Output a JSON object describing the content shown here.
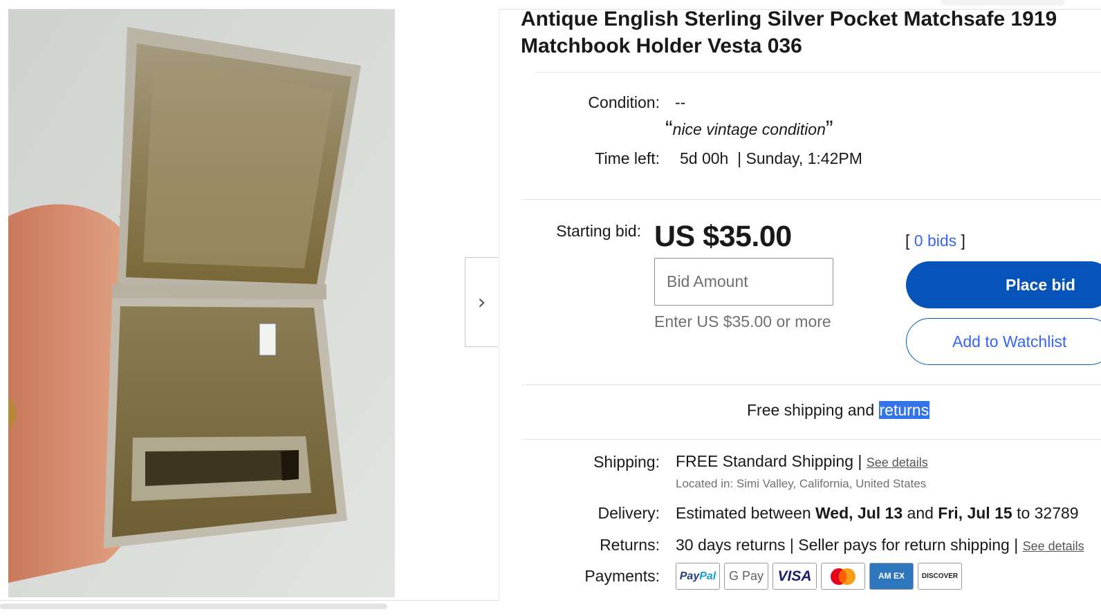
{
  "listing": {
    "title": "Antique English Sterling Silver Pocket Matchsafe 1919 Matchbook Holder Vesta 036",
    "condition_label": "Condition:",
    "condition_value": "--",
    "seller_note": "nice vintage condition",
    "time_left_label": "Time left:",
    "time_left_value": "5d 00h",
    "time_left_sep": "|",
    "end_time": "Sunday, 1:42PM"
  },
  "bidding": {
    "starting_bid_label": "Starting bid:",
    "price": "US $35.00",
    "bids_open": "[",
    "bids_link": "0 bids",
    "bids_close": "]",
    "bid_placeholder": "Bid Amount",
    "bid_hint": "Enter US $35.00 or more",
    "place_bid_label": "Place bid",
    "watchlist_label": "Add to Watchlist"
  },
  "banner": {
    "text": "Free shipping and",
    "highlight": "returns"
  },
  "details": {
    "shipping_label": "Shipping:",
    "shipping_bold": "FREE",
    "shipping_text": "Standard Shipping |",
    "shipping_link": "See details",
    "located_in": "Located in: Simi Valley, California, United States",
    "delivery_label": "Delivery:",
    "delivery_pre": "Estimated between",
    "delivery_date1": "Wed, Jul 13",
    "delivery_mid": "and",
    "delivery_date2": "Fri, Jul 15",
    "delivery_post": "to 32789",
    "returns_label": "Returns:",
    "returns_text": "30 days returns | Seller pays for return shipping |",
    "returns_link": "See details",
    "payments_label": "Payments:"
  },
  "payment_methods": [
    {
      "name": "PayPal",
      "icon": "paypal-icon"
    },
    {
      "name": "G Pay",
      "icon": "google-pay-icon"
    },
    {
      "name": "VISA",
      "icon": "visa-icon"
    },
    {
      "name": "Mastercard",
      "icon": "mastercard-icon"
    },
    {
      "name": "AM EX",
      "icon": "amex-icon"
    },
    {
      "name": "DISCOVER",
      "icon": "discover-icon"
    }
  ],
  "photo_tag": "8A55DB",
  "colors": {
    "primary_button": "#0654ba",
    "link": "#3665f3",
    "highlight": "#3375e8",
    "text": "#191919",
    "muted": "#707070"
  },
  "icons": {
    "gallery_next": "chevron-right-icon"
  }
}
